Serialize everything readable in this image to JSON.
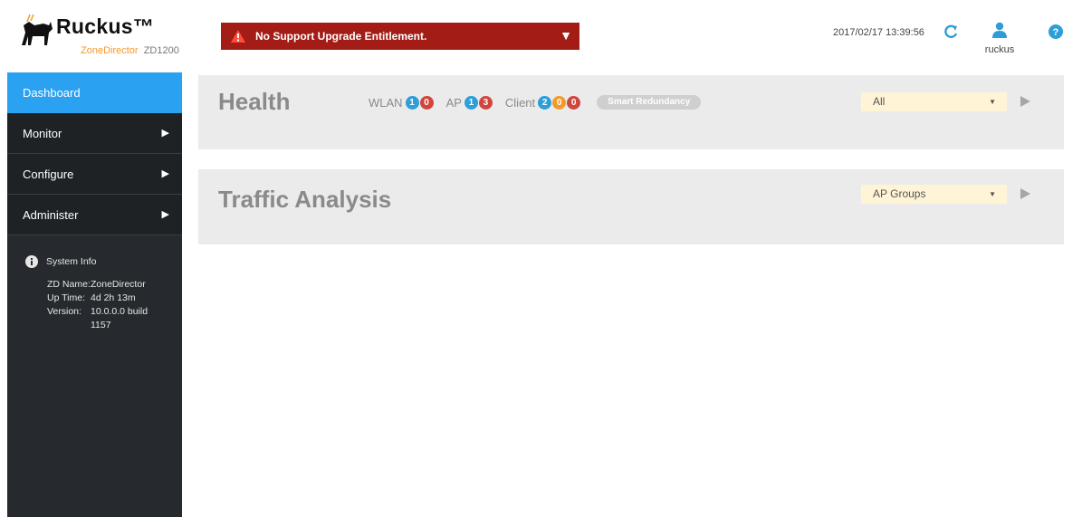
{
  "header": {
    "brand": "Ruckus™",
    "product": "ZoneDirector",
    "model": "ZD1200",
    "alert": "No Support Upgrade Entitlement.",
    "datetime": "2017/02/17  13:39:56",
    "username": "ruckus"
  },
  "sidebar": {
    "items": [
      {
        "label": "Dashboard",
        "active": true
      },
      {
        "label": "Monitor"
      },
      {
        "label": "Configure"
      },
      {
        "label": "Administer"
      }
    ],
    "system_info": {
      "title": "System Info",
      "zd_name_label": "ZD Name:",
      "zd_name": "ZoneDirector",
      "uptime_label": "Up Time:",
      "uptime": "4d 2h 13m",
      "version_label": "Version:",
      "version": "10.0.0.0 build 1157"
    }
  },
  "health": {
    "title": "Health",
    "wlan_label": "WLAN",
    "wlan_up": "1",
    "wlan_down": "0",
    "ap_label": "AP",
    "ap_up": "1",
    "ap_down": "3",
    "client_label": "Client",
    "client_a": "2",
    "client_b": "0",
    "client_c": "0",
    "smart_redundancy": "Smart Redundancy",
    "filter": "All"
  },
  "traffic": {
    "title": "Traffic Analysis",
    "filter": "AP Groups"
  },
  "colors": {
    "accent": "#2aa1f1",
    "alert_bg": "#a31d16",
    "sidebar_bg": "#262a2e",
    "badge_blue": "#2d9ed9",
    "badge_red": "#d0463e",
    "badge_orange": "#f39a2c"
  },
  "icons": [
    "ruckus-dog-logo-icon",
    "warning-triangle-icon",
    "dropdown-caret-icon",
    "refresh-icon",
    "user-icon",
    "help-icon",
    "nav-arrow-icon",
    "info-icon",
    "play-icon"
  ]
}
